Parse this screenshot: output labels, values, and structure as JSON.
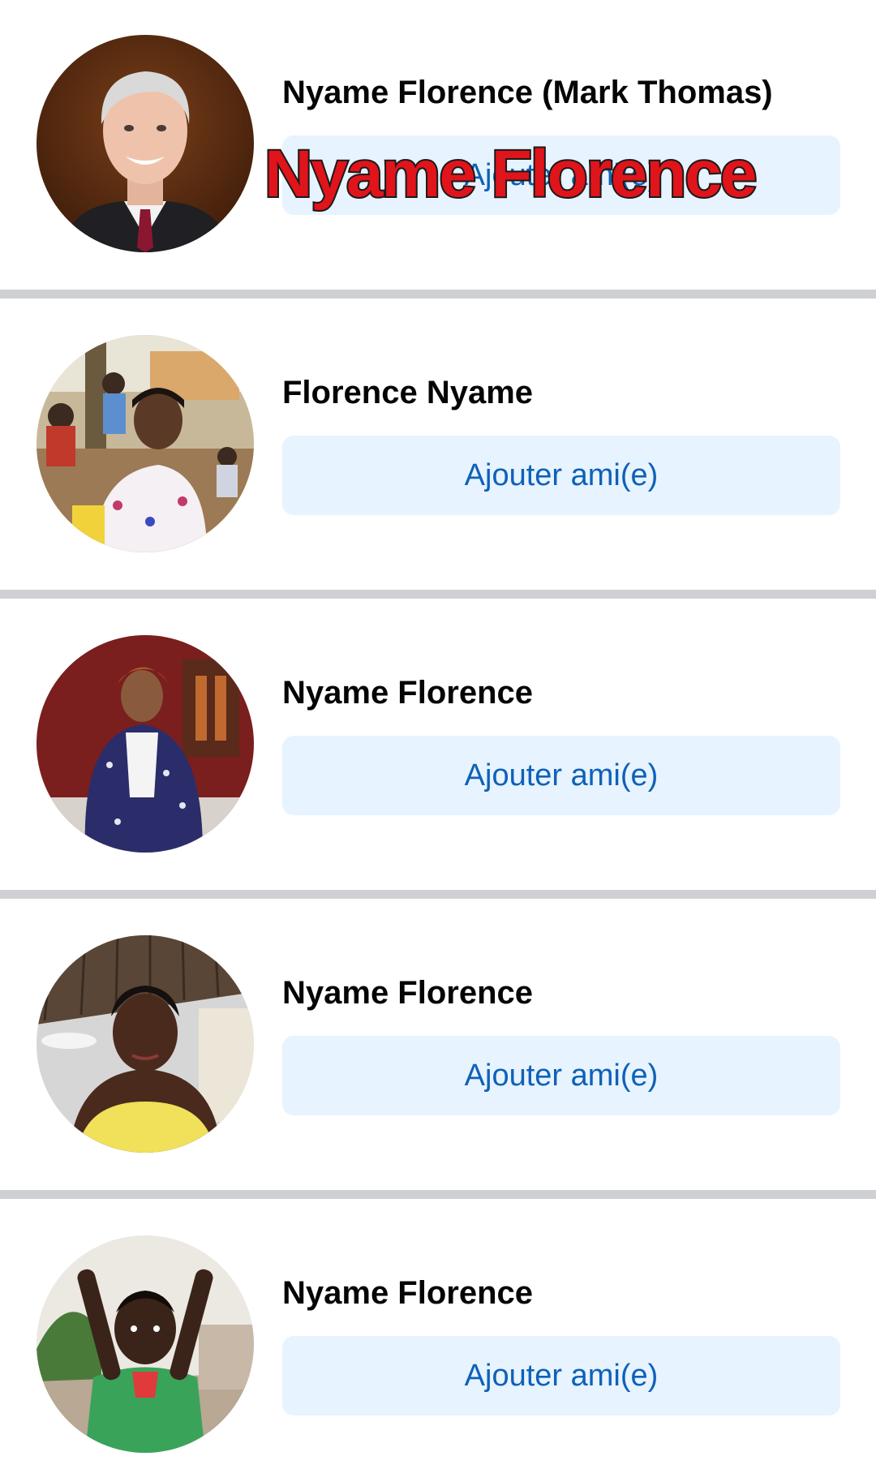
{
  "results": [
    {
      "name": "Nyame Florence (Mark Thomas)",
      "button_label": "Ajouter ami(e)",
      "avatar_icon": "man-gray-hair-suit-avatar",
      "overlay_caption": "Nyame Florence"
    },
    {
      "name": "Florence Nyame",
      "button_label": "Ajouter ami(e)",
      "avatar_icon": "woman-outdoor-crowd-avatar"
    },
    {
      "name": "Nyame Florence",
      "button_label": "Ajouter ami(e)",
      "avatar_icon": "woman-blue-wrap-avatar"
    },
    {
      "name": "Nyame Florence",
      "button_label": "Ajouter ami(e)",
      "avatar_icon": "woman-yellow-top-avatar"
    },
    {
      "name": "Nyame Florence",
      "button_label": "Ajouter ami(e)",
      "avatar_icon": "child-green-shirt-avatar"
    }
  ],
  "colors": {
    "button_bg": "#e7f3ff",
    "button_text": "#0e61b8",
    "divider": "#ced0d4",
    "overlay_fill": "#e0141b",
    "overlay_stroke": "#1a1a1a"
  }
}
